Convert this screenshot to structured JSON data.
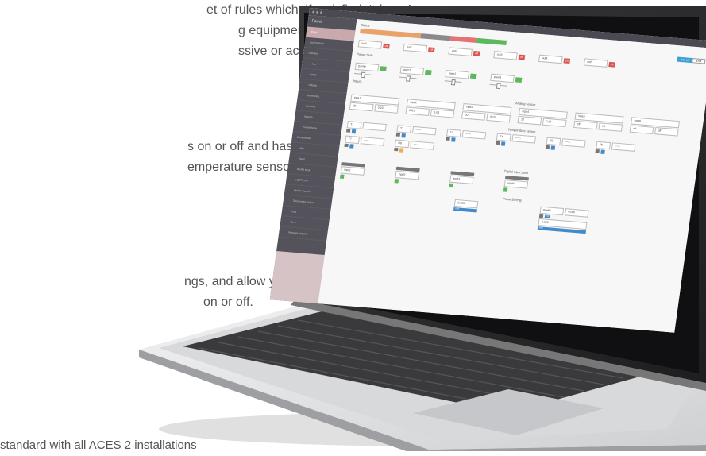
{
  "copy": {
    "line1": "et of rules which, if satisfied, ‘trigger’",
    "line2": "g equipment off yourself when",
    "line3": "ssive or active out-of-hours,",
    "line4": "s on or off and has the ability to",
    "line5": "emperature sensors.",
    "line6": "ngs, and allow you to",
    "line7": "on or off.",
    "line8": "standard with all ACES 2 installations"
  },
  "app": {
    "brand": "Panel",
    "status_title": "Status",
    "lang": {
      "webui": "Web UI",
      "selected": "EN ▾"
    },
    "colors": {
      "sidebar": "#54525a",
      "active": "#c9a9ad",
      "red": "#d9534f",
      "green": "#5cb85c",
      "blue": "#428bca",
      "amber": "#f0ad4e",
      "orange": "#e8a36a",
      "grey": "#8a8a8a",
      "salmon": "#e57373"
    }
  },
  "sidebar": [
    "Panel",
    "Load Scheme",
    "Overview",
    "Ana",
    "Inputs",
    "Outputs",
    "Interlocking",
    "Schedule",
    "Network",
    "PowerEnergy",
    "Configuration",
    "Info",
    "Reset",
    "RS485 Input",
    "MQTT Conf",
    "Update System",
    "Temperature sensor",
    "Logs",
    "Alarm",
    "Firmware Upgrade"
  ],
  "power_outs": {
    "title": "Power Outs",
    "items": [
      "out0",
      "out1",
      "out2",
      "out3",
      "out4",
      "out5"
    ],
    "btn": "Off"
  },
  "pwm": {
    "items": [
      "pwm0",
      "pwm1",
      "pwm2",
      "pwm3"
    ]
  },
  "inputs_title": "Inputs",
  "analog": {
    "title": "Analog sensor",
    "items": [
      {
        "name": "inpa1",
        "v1": "20",
        "v2": "0.20"
      },
      {
        "name": "inpa2",
        "v1": "0321",
        "v2": "6.04"
      },
      {
        "name": "inpa3",
        "v1": "20",
        "v2": "0.20"
      },
      {
        "name": "inpa4",
        "v1": "20",
        "v2": "0.20"
      },
      {
        "name": "inpa5",
        "v1": "off",
        "v2": "off"
      },
      {
        "name": "inpa6",
        "v1": "off",
        "v2": "off"
      }
    ]
  },
  "temp": {
    "title": "Temperature sensor",
    "items": [
      "T1",
      "T2",
      "T3",
      "T4",
      "T5",
      "T6",
      "T7",
      "H8"
    ],
    "value": "------"
  },
  "digital": {
    "title": "Digital input state",
    "items": [
      "inpd1",
      "inpd2",
      "inpd3",
      "inpd4"
    ]
  },
  "power": {
    "title": "PowerEnergy",
    "v1": "0.000",
    "u1": "kWh",
    "label": "power",
    "v2": "0.000",
    "u2": "kW",
    "v3": "0.000",
    "u3": "kWh"
  }
}
